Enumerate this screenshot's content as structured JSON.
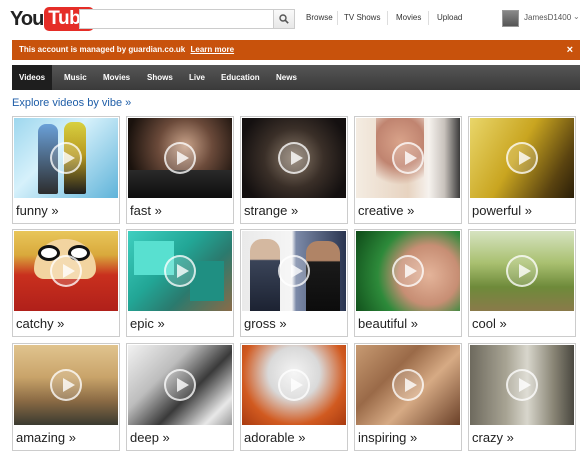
{
  "header": {
    "logo_you": "You",
    "logo_tube": "Tube",
    "search_placeholder": "",
    "nav": [
      "Browse",
      "TV Shows",
      "Movies",
      "Upload"
    ],
    "username": "JamesD1400"
  },
  "banner": {
    "text": "This account is managed by guardian.co.uk",
    "link": "Learn more",
    "close": "×",
    "color": "#c8520c"
  },
  "categories": [
    "Videos",
    "Music",
    "Movies",
    "Shows",
    "Live",
    "Education",
    "News"
  ],
  "active_category": "Videos",
  "explore_title": "Explore videos by vibe »",
  "vibes": [
    {
      "label": "funny »"
    },
    {
      "label": "fast »"
    },
    {
      "label": "strange »"
    },
    {
      "label": "creative »"
    },
    {
      "label": "powerful »"
    },
    {
      "label": "catchy »"
    },
    {
      "label": "epic »"
    },
    {
      "label": "gross »"
    },
    {
      "label": "beautiful »"
    },
    {
      "label": "cool »"
    },
    {
      "label": "amazing »"
    },
    {
      "label": "deep »"
    },
    {
      "label": "adorable »"
    },
    {
      "label": "inspiring »"
    },
    {
      "label": "crazy »"
    }
  ],
  "icons": {
    "search": "search-icon",
    "caret": "chevron-down-icon",
    "close": "close-icon",
    "play": "play-icon"
  }
}
